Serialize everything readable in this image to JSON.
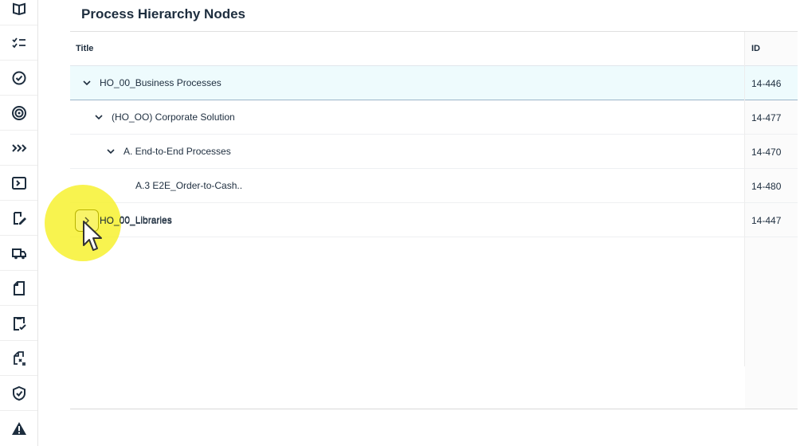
{
  "panel": {
    "title": "Process Hierarchy Nodes"
  },
  "table": {
    "headers": {
      "title": "Title",
      "id": "ID"
    },
    "rows": [
      {
        "title": "HO_00_Business Processes",
        "id": "14-446",
        "level": 0,
        "expand": "expanded",
        "selected": true
      },
      {
        "title": "(HO_OO) Corporate Solution",
        "id": "14-477",
        "level": 1,
        "expand": "expanded",
        "selected": false
      },
      {
        "title": "A. End-to-End Processes",
        "id": "14-470",
        "level": 2,
        "expand": "expanded",
        "selected": false
      },
      {
        "title": "A.3 E2E_Order-to-Cash..",
        "id": "14-480",
        "level": 3,
        "expand": "none",
        "selected": false
      },
      {
        "title": "HO_00_Libraries",
        "id": "14-447",
        "level": 0,
        "expand": "collapsed",
        "selected": false
      }
    ]
  },
  "sidebar": {
    "icons": [
      "book-icon",
      "checklist-icon",
      "badge-check-icon",
      "target-icon",
      "chevrons-right-icon",
      "process-icon",
      "edit-document-icon",
      "truck-icon",
      "document-icon",
      "clipboard-check-icon",
      "document-formula-icon",
      "shield-check-icon",
      "warning-icon"
    ]
  }
}
